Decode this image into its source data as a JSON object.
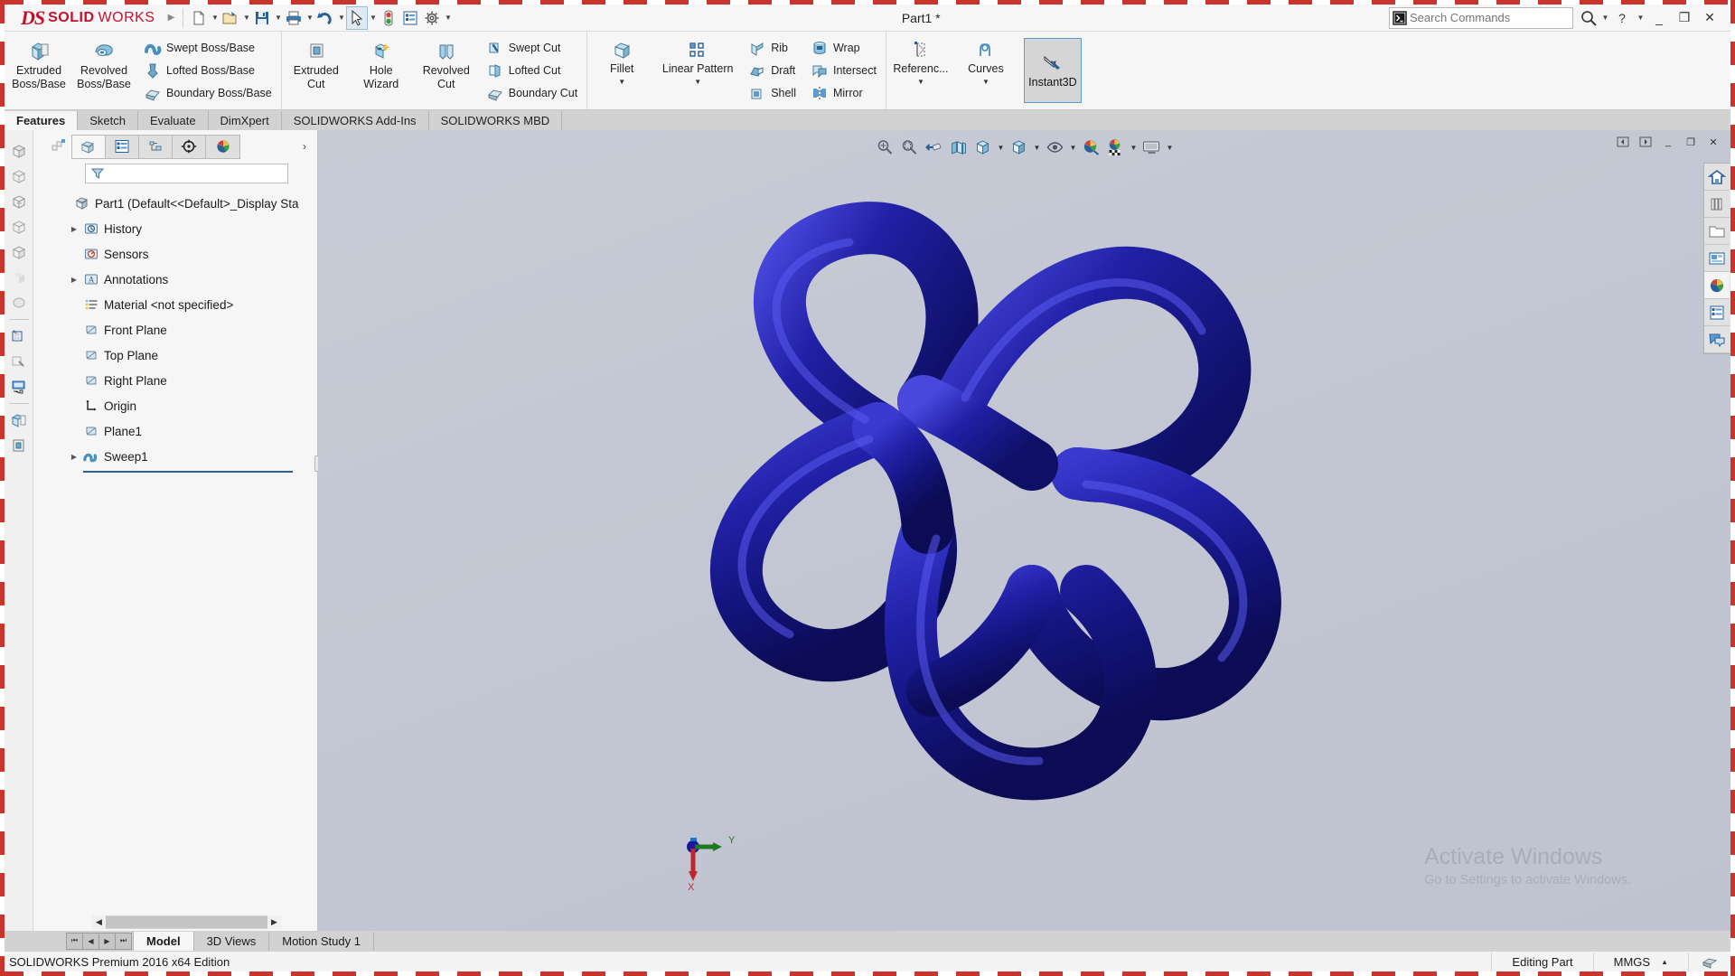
{
  "app": {
    "brand_ds": "DS",
    "brand_solid": "SOLID",
    "brand_works": "WORKS",
    "document_title": "Part1 *",
    "accent": "#c8102e",
    "selection_blue": "#5b9bd5",
    "model_color": "#1a1a99"
  },
  "titlebar": {
    "quick_access": [
      {
        "name": "new-document-icon",
        "caret": true
      },
      {
        "name": "open-document-icon",
        "caret": true
      },
      {
        "name": "save-icon",
        "caret": true
      },
      {
        "name": "print-icon",
        "caret": true
      },
      {
        "name": "undo-icon",
        "caret": true
      },
      {
        "name": "select-cursor-icon",
        "caret": true,
        "selected": true
      },
      {
        "name": "rebuild-icon",
        "caret": false
      },
      {
        "name": "file-properties-icon",
        "caret": false
      },
      {
        "name": "options-gear-icon",
        "caret": true
      }
    ],
    "search_placeholder": "Search Commands",
    "window_buttons": [
      "help",
      "help-caret",
      "minimize",
      "restore",
      "close"
    ]
  },
  "ribbon": {
    "groups": [
      {
        "name": "boss-base-group",
        "big": [
          {
            "label_line1": "Extruded",
            "label_line2": "Boss/Base",
            "icon": "extruded-boss-icon",
            "dropdown": false
          },
          {
            "label_line1": "Revolved",
            "label_line2": "Boss/Base",
            "icon": "revolved-boss-icon",
            "dropdown": false
          }
        ],
        "small": [
          {
            "label": "Swept Boss/Base",
            "icon": "swept-boss-icon"
          },
          {
            "label": "Lofted Boss/Base",
            "icon": "lofted-boss-icon"
          },
          {
            "label": "Boundary Boss/Base",
            "icon": "boundary-boss-icon"
          }
        ]
      },
      {
        "name": "cut-group",
        "big": [
          {
            "label_line1": "Extruded",
            "label_line2": "Cut",
            "icon": "extruded-cut-icon",
            "dropdown": false
          },
          {
            "label_line1": "Hole",
            "label_line2": "Wizard",
            "icon": "hole-wizard-icon",
            "dropdown": false
          },
          {
            "label_line1": "Revolved",
            "label_line2": "Cut",
            "icon": "revolved-cut-icon",
            "dropdown": false
          }
        ],
        "small": [
          {
            "label": "Swept Cut",
            "icon": "swept-cut-icon"
          },
          {
            "label": "Lofted Cut",
            "icon": "lofted-cut-icon"
          },
          {
            "label": "Boundary Cut",
            "icon": "boundary-cut-icon"
          }
        ]
      },
      {
        "name": "features-group",
        "big": [
          {
            "label_line1": "Fillet",
            "label_line2": "",
            "icon": "fillet-icon",
            "dropdown": true
          },
          {
            "label_line1": "Linear Pattern",
            "label_line2": "",
            "icon": "linear-pattern-icon",
            "dropdown": true
          }
        ],
        "small": [
          {
            "label": "Rib",
            "icon": "rib-icon"
          },
          {
            "label": "Draft",
            "icon": "draft-icon"
          },
          {
            "label": "Shell",
            "icon": "shell-icon"
          }
        ],
        "small2": [
          {
            "label": "Wrap",
            "icon": "wrap-icon"
          },
          {
            "label": "Intersect",
            "icon": "intersect-icon"
          },
          {
            "label": "Mirror",
            "icon": "mirror-icon"
          }
        ]
      },
      {
        "name": "geometry-group",
        "big": [
          {
            "label_line1": "Referenc...",
            "label_line2": "",
            "icon": "reference-geometry-icon",
            "dropdown": true
          },
          {
            "label_line1": "Curves",
            "label_line2": "",
            "icon": "curves-icon",
            "dropdown": true
          }
        ]
      }
    ],
    "instant3d": {
      "label": "Instant3D",
      "icon": "instant3d-icon",
      "active": true
    },
    "tabs": [
      {
        "label": "Features",
        "active": true
      },
      {
        "label": "Sketch",
        "active": false
      },
      {
        "label": "Evaluate",
        "active": false
      },
      {
        "label": "DimXpert",
        "active": false
      },
      {
        "label": "SOLIDWORKS Add-Ins",
        "active": false
      },
      {
        "label": "SOLIDWORKS MBD",
        "active": false
      }
    ]
  },
  "left_rail": {
    "items": [
      {
        "name": "view-orientation-icon"
      },
      {
        "name": "wireframe-view-icon"
      },
      {
        "name": "hidden-lines-visible-icon"
      },
      {
        "name": "hidden-lines-removed-icon"
      },
      {
        "name": "shaded-with-edges-icon"
      },
      {
        "name": "shaded-icon"
      },
      {
        "name": "draft-quality-icon"
      },
      {
        "name": "sketch-icon"
      },
      {
        "name": "repair-sketch-icon"
      },
      {
        "name": "display-pane-icon"
      },
      {
        "name": "extruded-boss-rail-icon"
      },
      {
        "name": "extruded-cut-rail-icon"
      }
    ]
  },
  "feature_manager": {
    "tabs": [
      {
        "name": "feature-tree-tab",
        "icon": "feature-tree-icon",
        "active": true
      },
      {
        "name": "property-manager-tab",
        "icon": "property-manager-icon",
        "active": false
      },
      {
        "name": "configuration-manager-tab",
        "icon": "configuration-manager-icon",
        "active": false
      },
      {
        "name": "dimxpert-manager-tab",
        "icon": "dimxpert-manager-icon",
        "active": false
      },
      {
        "name": "display-manager-tab",
        "icon": "display-manager-icon",
        "active": false
      }
    ],
    "more_chevron": "›",
    "filter_placeholder": "",
    "filter_icon": "filter-funnel-icon",
    "tree": [
      {
        "label": "Part1  (Default<<Default>_Display Sta",
        "icon": "part-icon",
        "expandable": false,
        "level": 0
      },
      {
        "label": "History",
        "icon": "history-folder-icon",
        "expandable": true,
        "level": 1
      },
      {
        "label": "Sensors",
        "icon": "sensors-folder-icon",
        "expandable": false,
        "level": 1
      },
      {
        "label": "Annotations",
        "icon": "annotations-folder-icon",
        "expandable": true,
        "level": 1
      },
      {
        "label": "Material <not specified>",
        "icon": "material-icon",
        "expandable": false,
        "level": 1
      },
      {
        "label": "Front Plane",
        "icon": "plane-icon",
        "expandable": false,
        "level": 1
      },
      {
        "label": "Top Plane",
        "icon": "plane-icon",
        "expandable": false,
        "level": 1
      },
      {
        "label": "Right Plane",
        "icon": "plane-icon",
        "expandable": false,
        "level": 1
      },
      {
        "label": "Origin",
        "icon": "origin-icon",
        "expandable": false,
        "level": 1
      },
      {
        "label": "Plane1",
        "icon": "plane-icon",
        "expandable": false,
        "level": 1
      },
      {
        "label": "Sweep1",
        "icon": "sweep-feature-icon",
        "expandable": true,
        "level": 1
      }
    ]
  },
  "graphics": {
    "view_toolbar": [
      {
        "name": "zoom-to-fit-icon",
        "caret": false
      },
      {
        "name": "zoom-to-area-icon",
        "caret": false
      },
      {
        "name": "previous-view-icon",
        "caret": false
      },
      {
        "name": "section-view-icon",
        "caret": false
      },
      {
        "name": "view-orientation-icon",
        "caret": true
      },
      {
        "name": "display-style-icon",
        "caret": true
      },
      {
        "name": "hide-show-items-icon",
        "caret": true
      },
      {
        "name": "edit-appearance-icon",
        "caret": false
      },
      {
        "name": "apply-scene-icon",
        "caret": true
      },
      {
        "name": "view-settings-icon",
        "caret": true
      }
    ],
    "window_controls": [
      "restore-left",
      "restore-right",
      "minimize",
      "restore",
      "close"
    ],
    "triad_axes": {
      "y": "Y",
      "x": "X"
    },
    "watermark_line1": "Activate Windows",
    "watermark_line2": "Go to Settings to activate Windows."
  },
  "task_pane": {
    "items": [
      {
        "name": "solidworks-resources-icon",
        "active": false
      },
      {
        "name": "design-library-icon",
        "active": false
      },
      {
        "name": "file-explorer-icon",
        "active": false
      },
      {
        "name": "view-palette-icon",
        "active": false
      },
      {
        "name": "appearances-scenes-decals-icon",
        "active": true
      },
      {
        "name": "custom-properties-icon",
        "active": false
      },
      {
        "name": "solidworks-forum-icon",
        "active": false
      }
    ]
  },
  "bottom": {
    "nav_buttons": [
      "first-tab",
      "prev-tab",
      "next-tab",
      "last-tab"
    ],
    "tabs": [
      {
        "label": "Model",
        "active": true
      },
      {
        "label": "3D Views",
        "active": false
      },
      {
        "label": "Motion Study 1",
        "active": false
      }
    ]
  },
  "statusbar": {
    "left": "SOLIDWORKS Premium 2016 x64 Edition",
    "editing": "Editing Part",
    "units": "MMGS",
    "units_caret": "▲",
    "overlay_icon": "rebuild-status-icon"
  }
}
